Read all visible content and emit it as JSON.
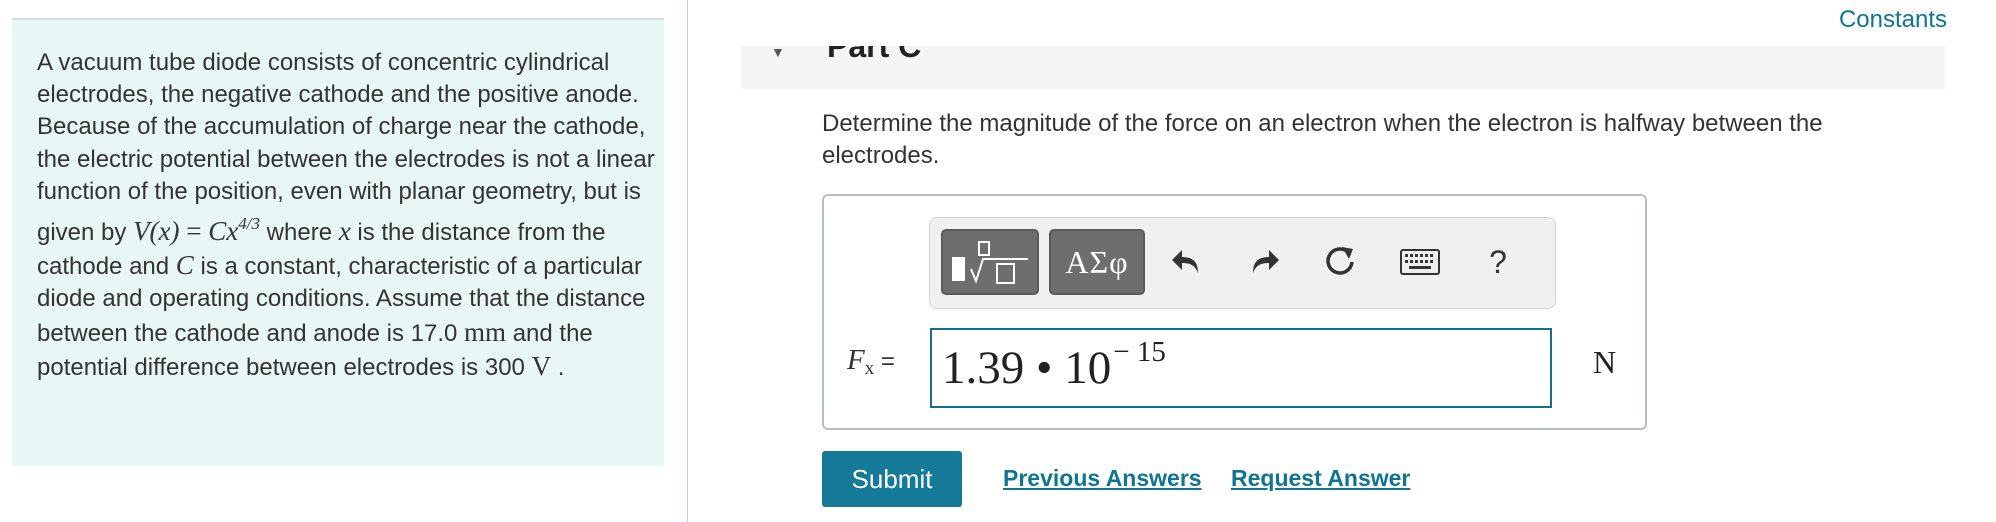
{
  "problem": {
    "text_1": "A vacuum tube diode consists of concentric cylindrical electrodes, the negative cathode and the positive anode. Because of the accumulation of charge near the cathode, the electric potential between the electrodes is not a linear function of the position, even with planar geometry, but is given by ",
    "formula_lhs": "V(x)",
    "formula_eq": " = ",
    "formula_rhs": "Cx",
    "formula_exp": "4/3",
    "text_2": " where ",
    "var_x": "x",
    "text_3": " is the distance from the cathode and ",
    "var_c": "C",
    "text_4": " is a constant, characteristic of a particular diode and operating conditions. Assume that the distance between the cathode and anode is 17.0 ",
    "unit_mm": "mm",
    "text_5": " and the potential difference between electrodes is 300 ",
    "unit_v": "V",
    "text_6": " ."
  },
  "header": {
    "constants_link": "Constants",
    "part_title": "Part C"
  },
  "question": {
    "text": "Determine the magnitude of the force on an electron when the electron is halfway between the electrodes."
  },
  "toolbar": {
    "symbols_label": "ΑΣφ",
    "help_label": "?"
  },
  "answer": {
    "var": "F",
    "sub": "x",
    "eq": " = ",
    "mantissa": "1.39 • 10",
    "exponent": "− 15",
    "unit": "N"
  },
  "actions": {
    "submit": "Submit",
    "previous_answers": "Previous Answers",
    "request_answer": "Request Answer"
  },
  "colors": {
    "accent": "#157a98",
    "link": "#0e7593",
    "panel_bg": "#e8f6f6"
  }
}
